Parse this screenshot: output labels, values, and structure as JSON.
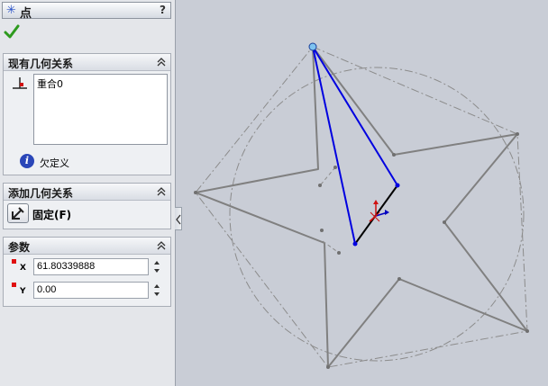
{
  "title": {
    "icon": "point-icon",
    "text": "点",
    "help": "?"
  },
  "confirm": {
    "icon": "checkmark-icon"
  },
  "existing_relations": {
    "header": "现有几何关系",
    "items": [
      "重合0"
    ],
    "status": "欠定义"
  },
  "add_relations": {
    "header": "添加几何关系",
    "fix_label": "固定(F)"
  },
  "parameters": {
    "header": "参数",
    "x_sub": "X",
    "y_sub": "Y",
    "x_value": "61.80339888",
    "y_value": "0.00"
  },
  "colors": {
    "panel_bg": "#e4e6ea",
    "canvas_bg": "#c9cdd6",
    "sketch_line": "#808080",
    "selected_line": "#0000e0",
    "active_line": "#000000",
    "point": "#7ec3f0"
  }
}
